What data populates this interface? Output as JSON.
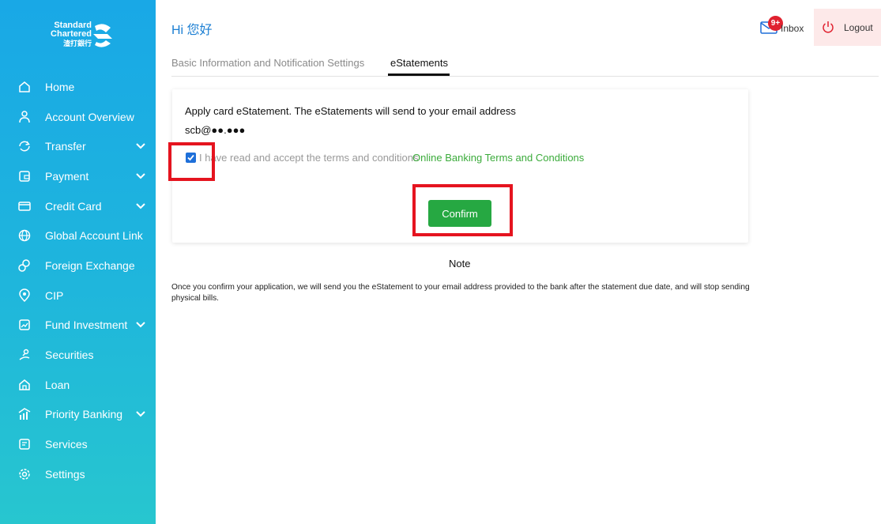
{
  "brand": {
    "logo_line1": "Standard",
    "logo_line2": "Chartered",
    "logo_line3": "渣打銀行"
  },
  "sidebar": {
    "items": [
      {
        "label": "Home",
        "icon": "home-icon",
        "expandable": false
      },
      {
        "label": "Account Overview",
        "icon": "user-icon",
        "expandable": false
      },
      {
        "label": "Transfer",
        "icon": "transfer-icon",
        "expandable": true
      },
      {
        "label": "Payment",
        "icon": "wallet-icon",
        "expandable": true
      },
      {
        "label": "Credit Card",
        "icon": "credit-card-icon",
        "expandable": true
      },
      {
        "label": "Global Account Link",
        "icon": "globe-icon",
        "expandable": false
      },
      {
        "label": "Foreign Exchange",
        "icon": "exchange-icon",
        "expandable": false
      },
      {
        "label": "CIP",
        "icon": "cip-icon",
        "expandable": false
      },
      {
        "label": "Fund Investment",
        "icon": "fund-icon",
        "expandable": true
      },
      {
        "label": "Securities",
        "icon": "securities-icon",
        "expandable": false
      },
      {
        "label": "Loan",
        "icon": "loan-icon",
        "expandable": false
      },
      {
        "label": "Priority Banking",
        "icon": "priority-banking-icon",
        "expandable": true
      },
      {
        "label": "Services",
        "icon": "services-icon",
        "expandable": false
      },
      {
        "label": "Settings",
        "icon": "settings-icon",
        "expandable": false
      }
    ]
  },
  "header": {
    "greeting": "Hi 您好",
    "inbox_label": "Inbox",
    "inbox_badge": "9+",
    "logout_label": "Logout"
  },
  "tabs": {
    "basic": "Basic Information and Notification Settings",
    "estatements": "eStatements",
    "active": "eStatements"
  },
  "card": {
    "apply_text": "Apply card eStatement. The eStatements will send to your email address",
    "email_masked": "scb@●●.●●●",
    "checkbox_checked": true,
    "accept_text": "I have read and accept the terms and conditions",
    "terms_link": "Online Banking Terms and Conditions",
    "confirm_label": "Confirm"
  },
  "note": {
    "title": "Note",
    "text": "Once you confirm your application, we will send you the eStatement to your email address provided to the bank after the statement due date, and will stop sending physical bills."
  },
  "colors": {
    "sidebar_top": "#19a8e6",
    "sidebar_bottom": "#27c6cf",
    "primary_green": "#26a842",
    "link_green": "#3bab3b",
    "highlight_red": "#e5141f",
    "greeting_blue": "#1c7fd3"
  }
}
